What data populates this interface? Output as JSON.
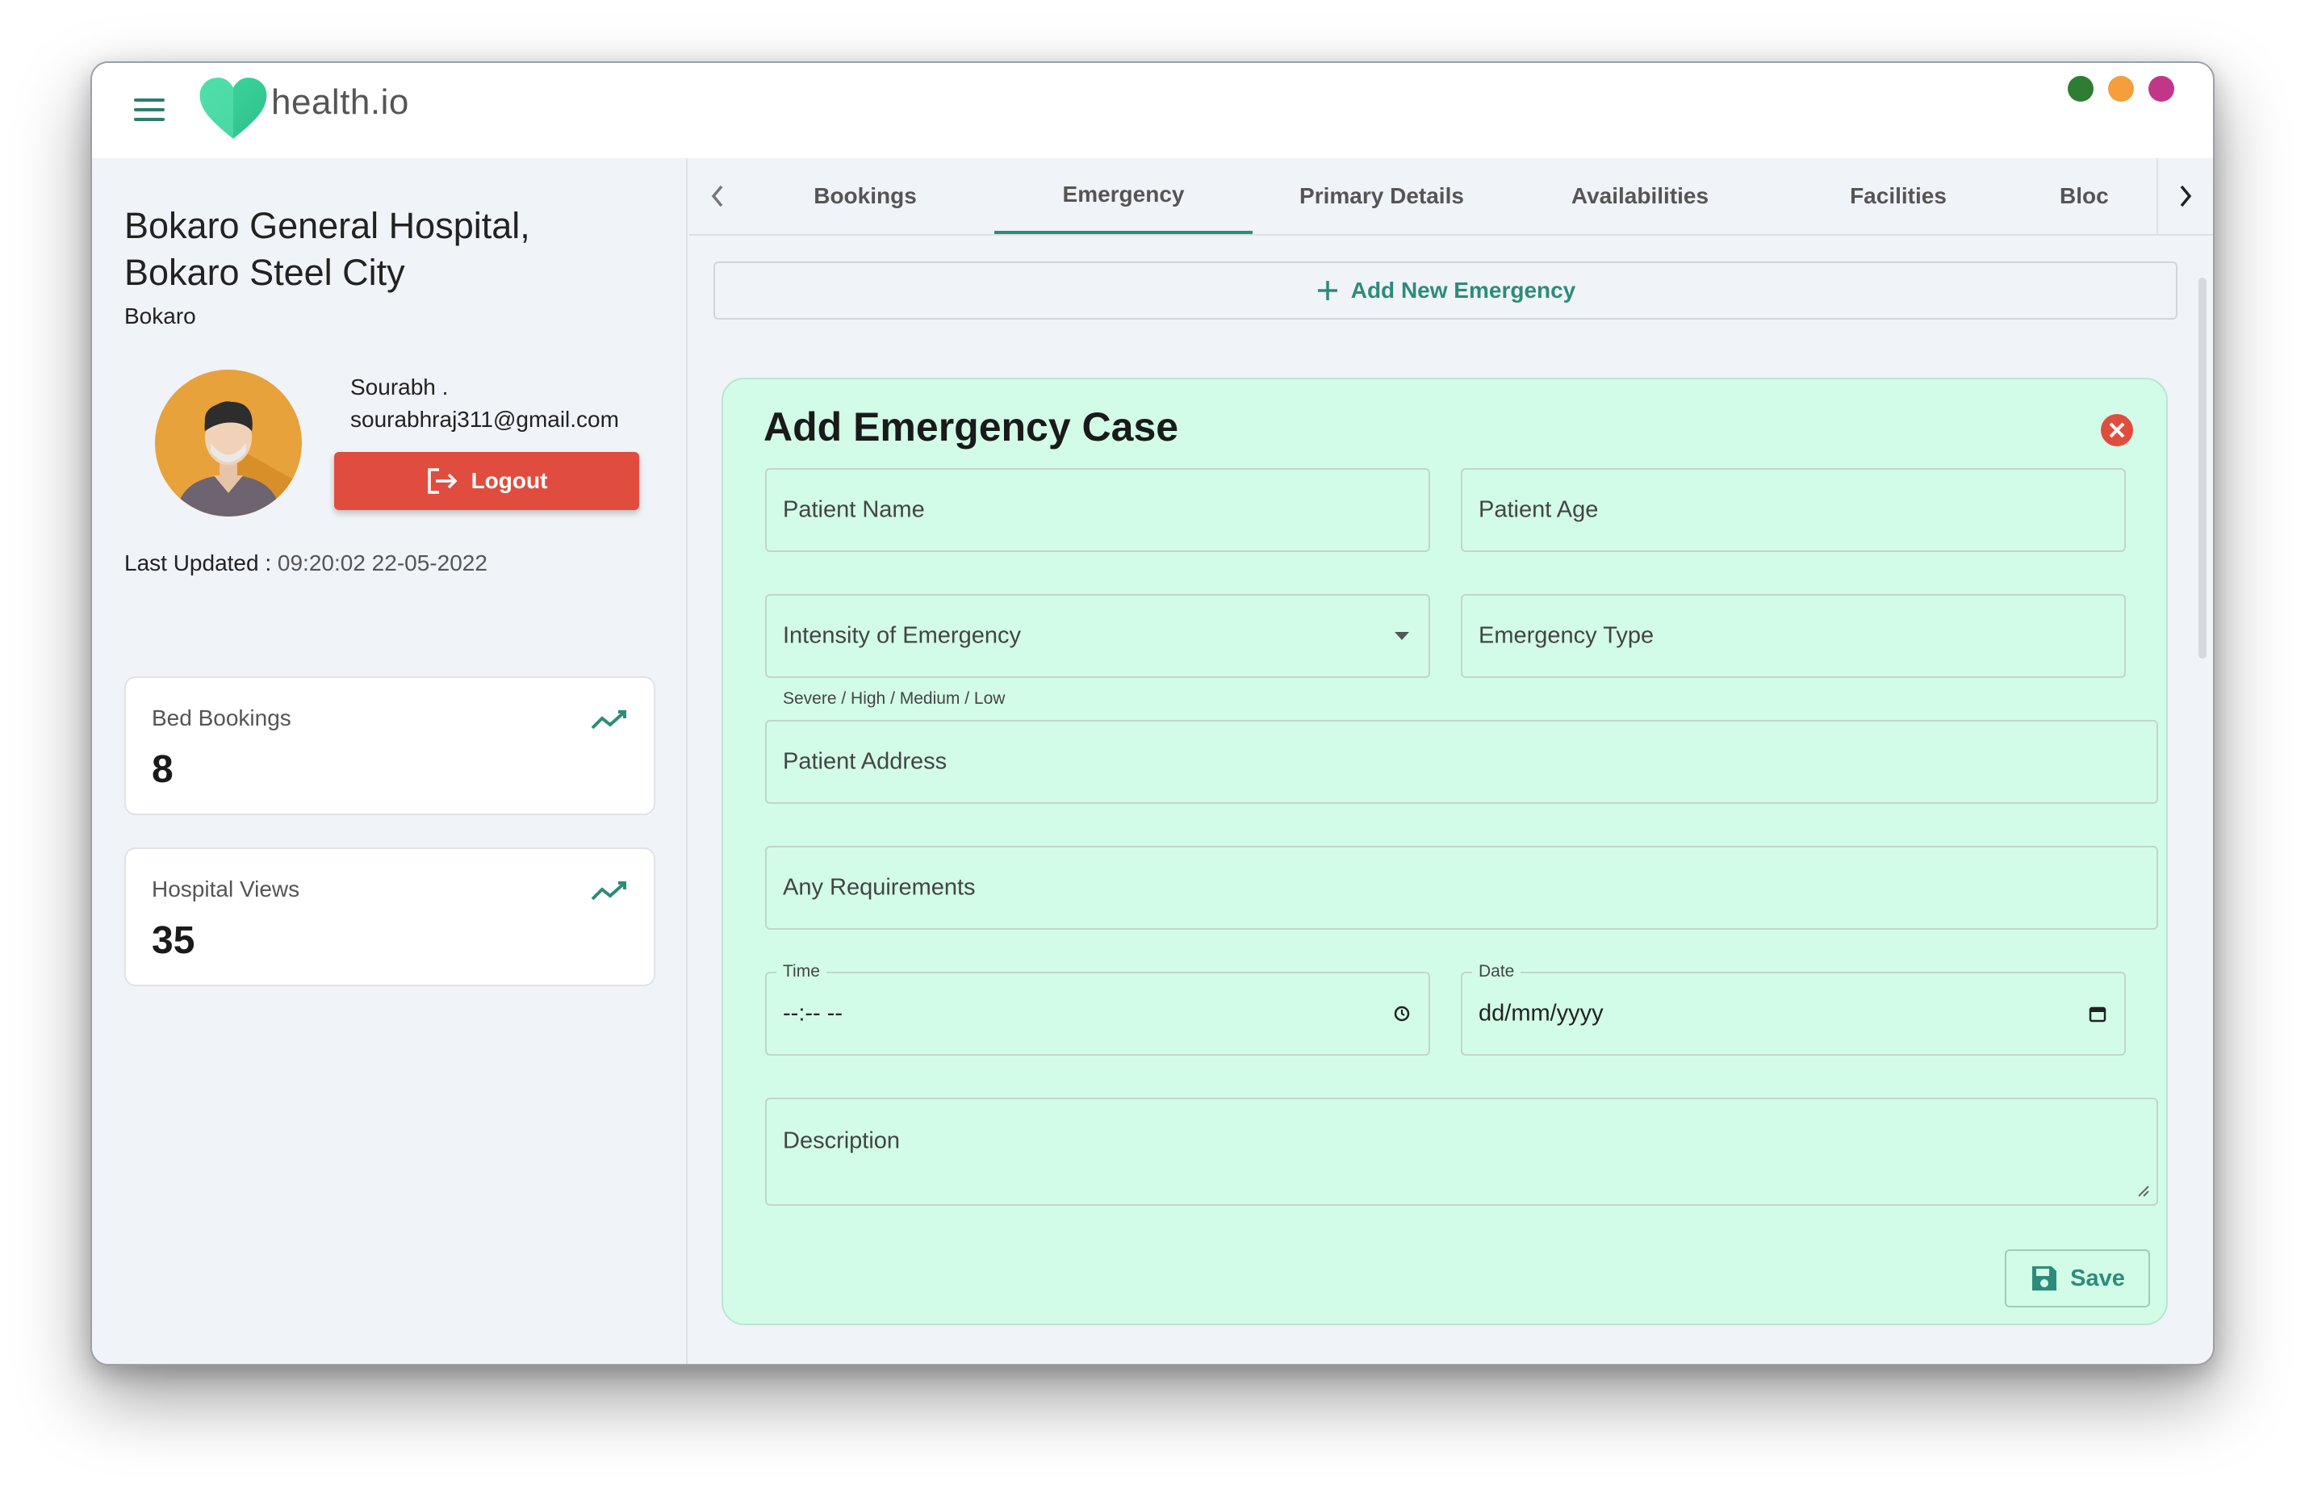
{
  "app": {
    "logo_text": "health.io",
    "window_dot_colors": [
      "#2e7d32",
      "#f59e3b",
      "#c2368a"
    ],
    "accent_color": "#2e8b7a",
    "danger_color": "#e04d3e",
    "form_bg_color": "#d2fce8"
  },
  "sidebar": {
    "hospital_name": "Bokaro General Hospital, Bokaro Steel City",
    "city": "Bokaro",
    "user_name": "Sourabh .",
    "user_email": "sourabhraj311@gmail.com",
    "logout_label": "Logout",
    "last_updated_label": "Last Updated :",
    "last_updated_value": "09:20:02 22-05-2022",
    "stats": [
      {
        "label": "Bed Bookings",
        "value": "8",
        "icon": "trending-up-icon"
      },
      {
        "label": "Hospital Views",
        "value": "35",
        "icon": "trending-up-icon"
      }
    ]
  },
  "tabs": {
    "items": [
      {
        "label": "Bookings"
      },
      {
        "label": "Emergency"
      },
      {
        "label": "Primary Details"
      },
      {
        "label": "Availabilities"
      },
      {
        "label": "Facilities"
      },
      {
        "label": "Bloc"
      }
    ],
    "active": "Emergency"
  },
  "main": {
    "add_new_label": "Add New Emergency",
    "form": {
      "title": "Add Emergency Case",
      "patient_name_placeholder": "Patient Name",
      "patient_age_placeholder": "Patient Age",
      "intensity_placeholder": "Intensity of Emergency",
      "intensity_helper": "Severe / High / Medium / Low",
      "emergency_type_placeholder": "Emergency Type",
      "address_placeholder": "Patient Address",
      "requirements_placeholder": "Any Requirements",
      "time_label": "Time",
      "time_value": "--:-- --",
      "date_label": "Date",
      "date_value": "dd/mm/yyyy",
      "description_placeholder": "Description",
      "save_label": "Save"
    }
  }
}
